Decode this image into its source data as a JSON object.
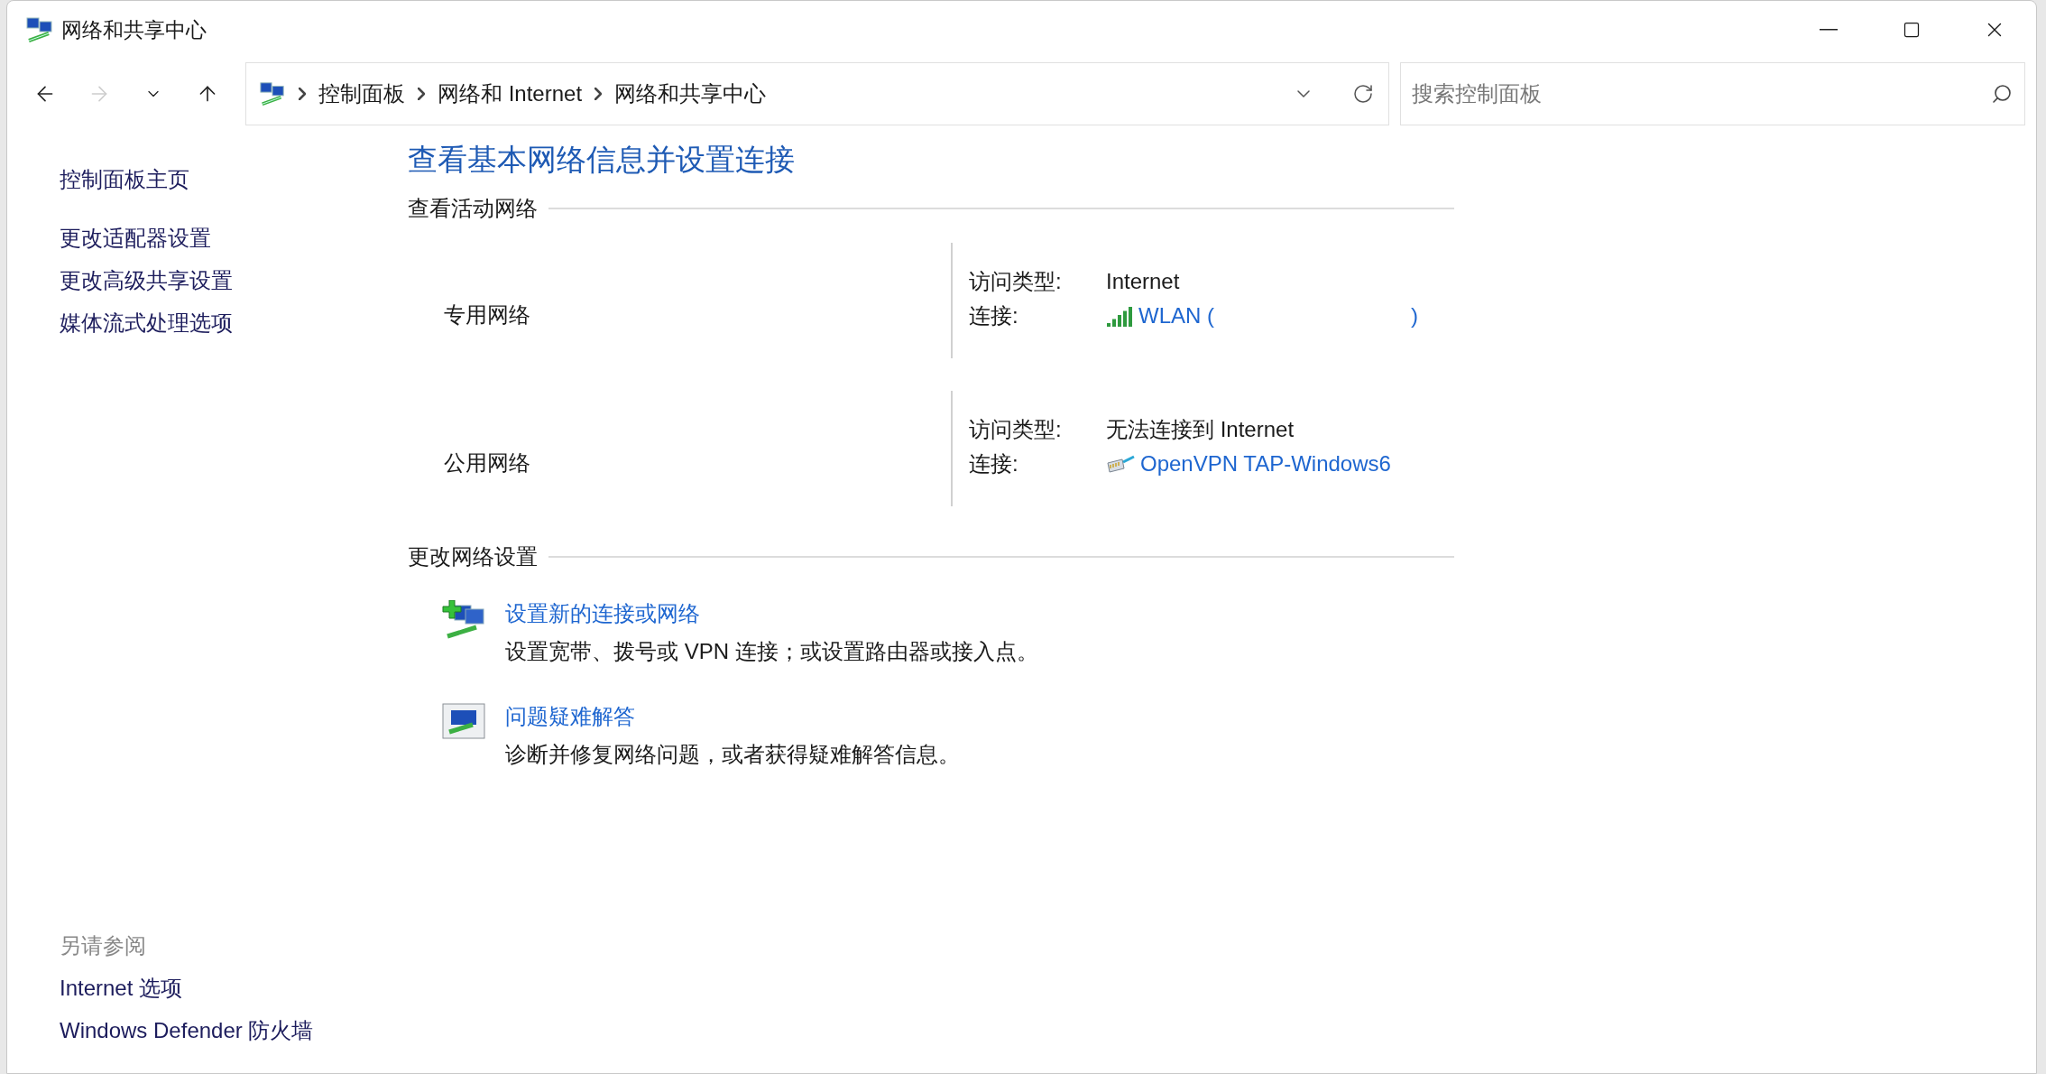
{
  "window": {
    "title": "网络和共享中心"
  },
  "nav": [
    {
      "kind": "back",
      "disabled": false
    },
    {
      "kind": "forward",
      "disabled": true
    },
    {
      "kind": "recent",
      "disabled": false
    },
    {
      "kind": "up",
      "disabled": false
    }
  ],
  "breadcrumb": [
    "控制面板",
    "网络和 Internet",
    "网络和共享中心"
  ],
  "search": {
    "placeholder": "搜索控制面板"
  },
  "sidebar": {
    "items": [
      "控制面板主页",
      "更改适配器设置",
      "更改高级共享设置",
      "媒体流式处理选项"
    ],
    "see_also": {
      "heading": "另请参阅",
      "items": [
        "Internet 选项",
        "Windows Defender 防火墙"
      ]
    }
  },
  "main": {
    "title": "查看基本网络信息并设置连接",
    "active_heading": "查看活动网络",
    "networks": [
      {
        "name": "专用网络",
        "access_label": "访问类型:",
        "access": "Internet",
        "connection_label": "连接:",
        "kind": "wifi",
        "link": "WLAN (",
        "link_end": ")"
      },
      {
        "name": "公用网络",
        "access_label": "访问类型:",
        "access": "无法连接到 Internet",
        "connection_label": "连接:",
        "kind": "ethernet",
        "link": "OpenVPN TAP-Windows6"
      }
    ],
    "settings_heading": "更改网络设置",
    "tasks": [
      {
        "kind": "setup",
        "link": "设置新的连接或网络",
        "description": "设置宽带、拨号或 VPN 连接；或设置路由器或接入点。"
      },
      {
        "kind": "troubleshoot",
        "link": "问题疑难解答",
        "description": "诊断并修复网络问题，或者获得疑难解答信息。"
      }
    ]
  }
}
